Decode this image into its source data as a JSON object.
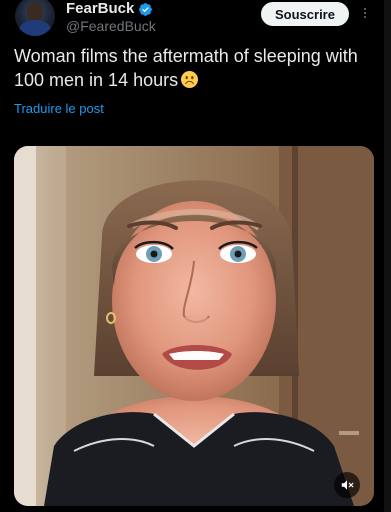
{
  "header": {
    "display_name": "FearBuck",
    "handle": "@FearedBuck",
    "subscribe_label": "Souscrire"
  },
  "post": {
    "text": "Woman films the aftermath of sleeping with 100 men in 14 hours",
    "emoji": "slightly-frowning-face",
    "translate_label": "Traduire le post"
  },
  "media": {
    "type": "video",
    "mute_icon": "muted-speaker-icon"
  },
  "colors": {
    "background": "#000000",
    "text": "#e7e9ea",
    "secondary_text": "#71767b",
    "link": "#1d9bf0",
    "verified": "#1d9bf0",
    "button_bg": "#eff3f4"
  }
}
